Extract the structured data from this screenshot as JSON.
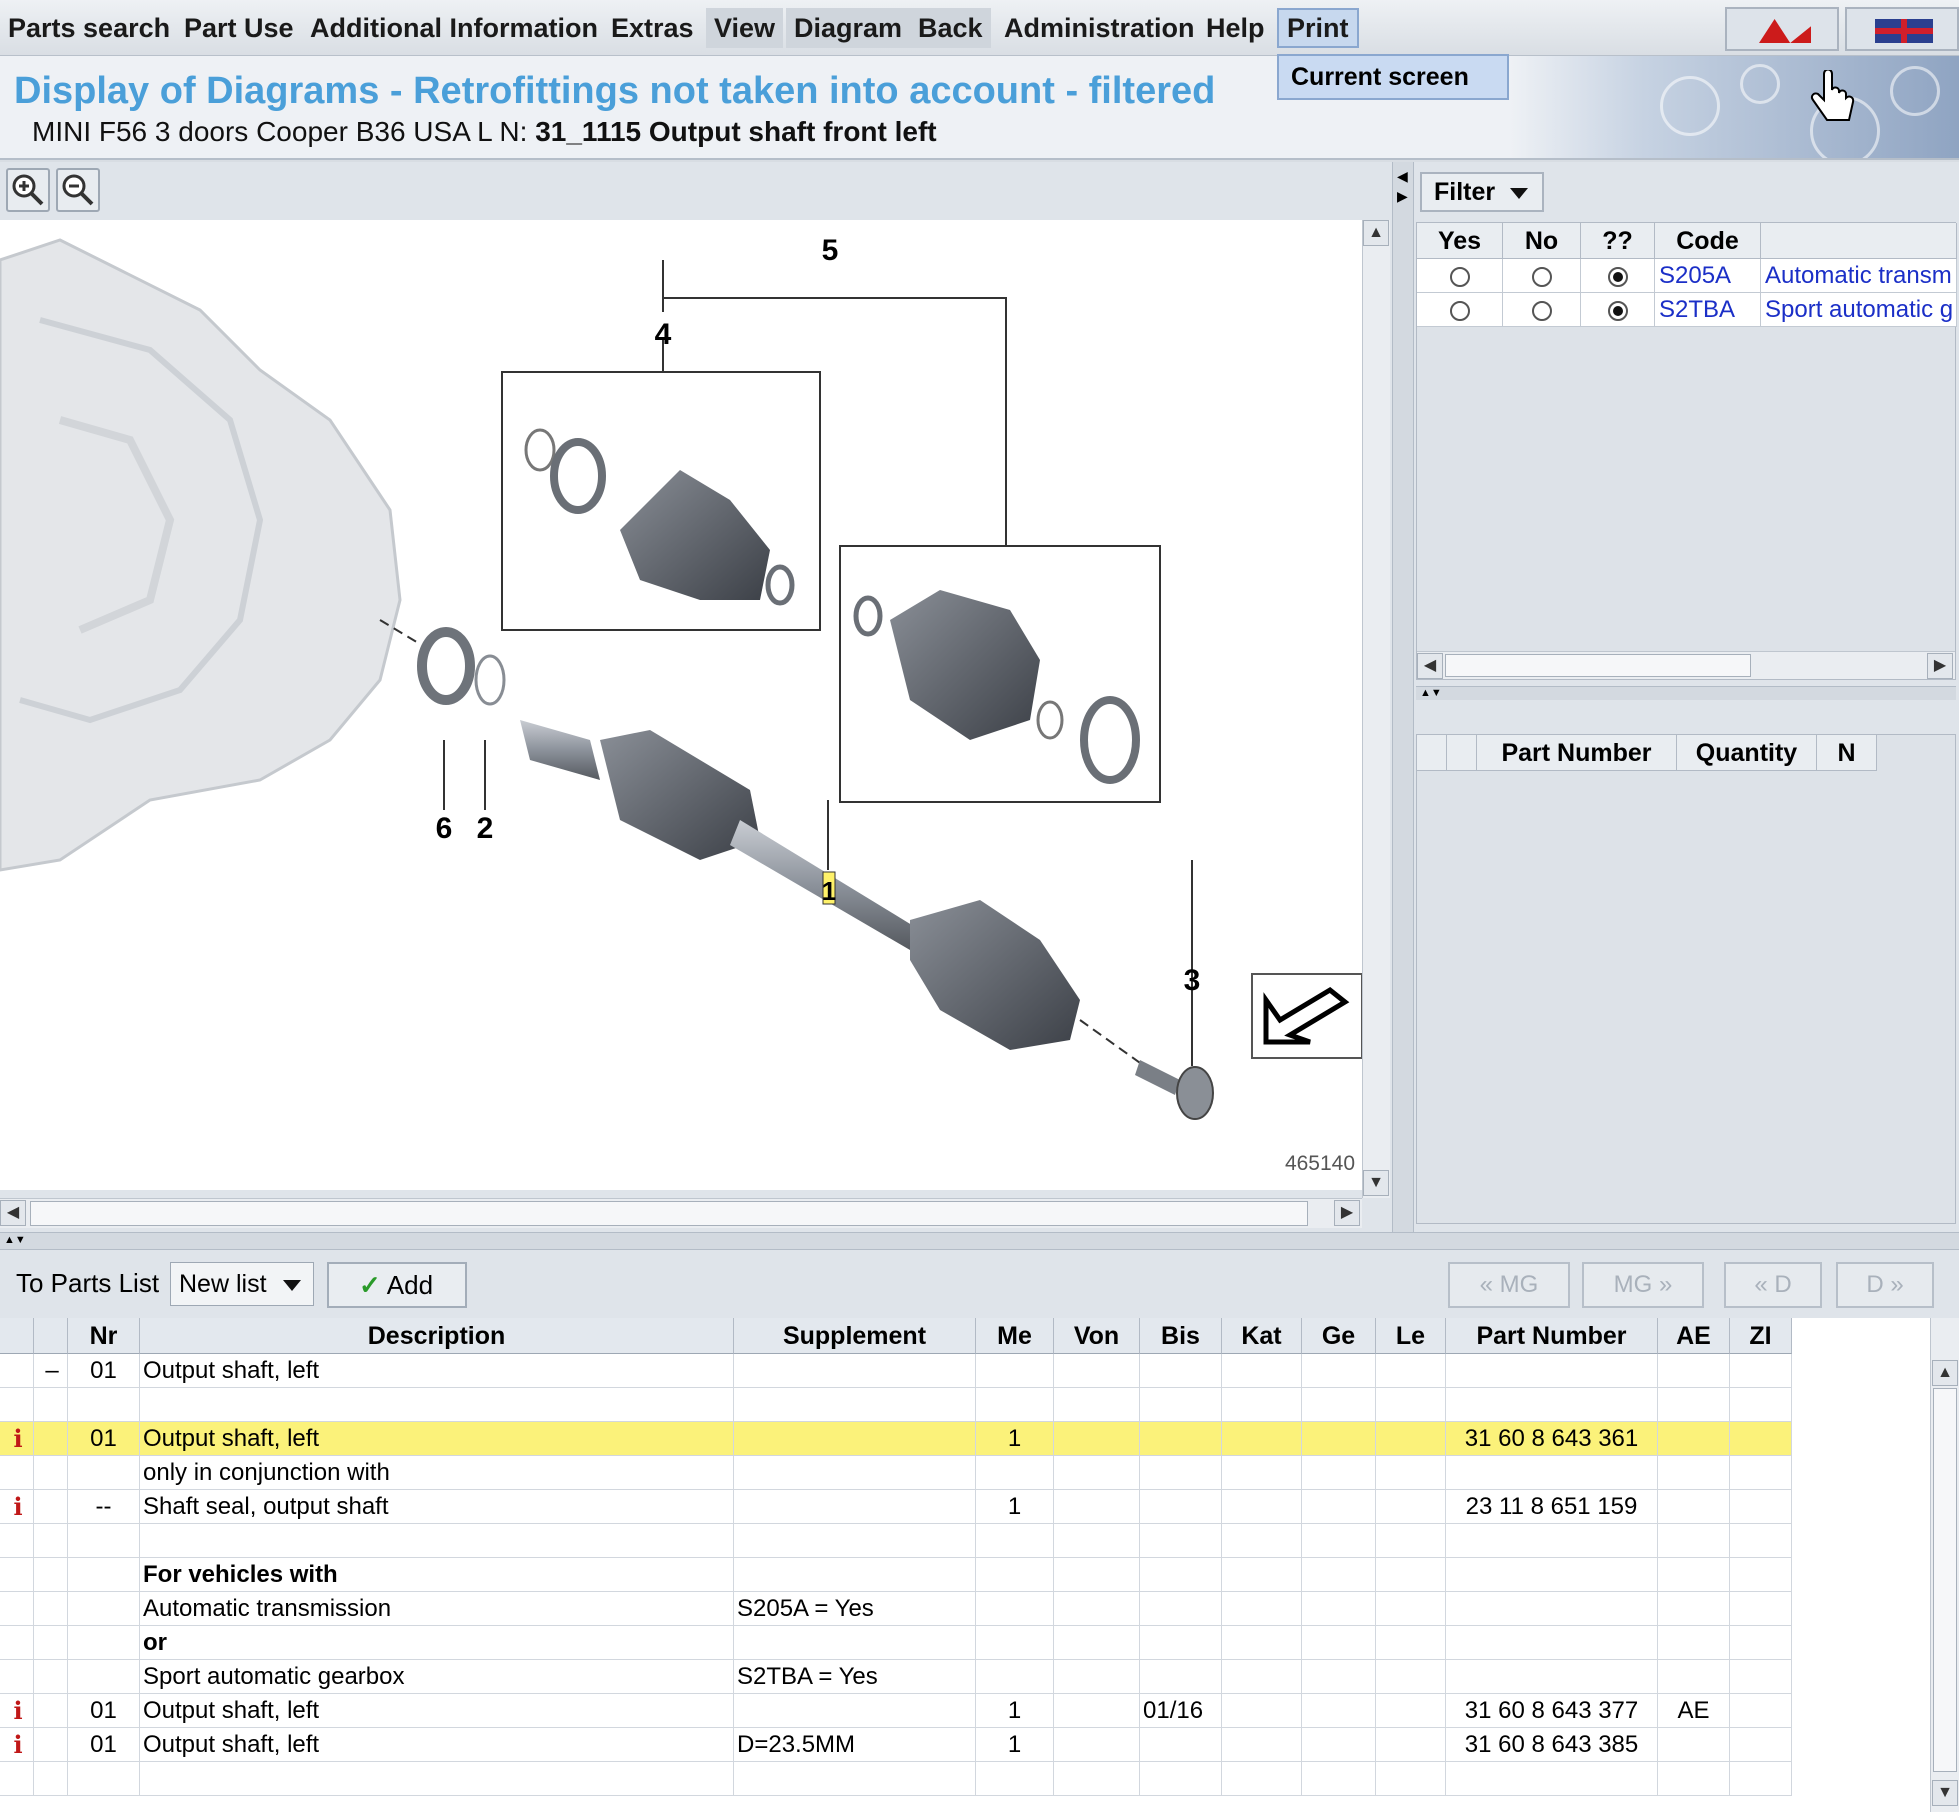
{
  "menu": {
    "items": [
      "Parts search",
      "Part Use",
      "Additional Information",
      "Extras",
      "View",
      "Diagram",
      "Back",
      "Administration",
      "Help",
      "Print"
    ],
    "print_dropdown_item": "Current screen"
  },
  "header": {
    "title": "Display of Diagrams - Retrofittings not taken into account - filtered",
    "vehicle_prefix": "MINI F56 3 doors Cooper B36 USA  L N:",
    "diagram_name": "31_1115 Output shaft front left"
  },
  "diagram": {
    "callouts": [
      "5",
      "4",
      "6",
      "2",
      "1",
      "3"
    ],
    "image_number": "465140"
  },
  "filter": {
    "button_label": "Filter",
    "columns": [
      "Yes",
      "No",
      "??",
      "Code",
      ""
    ],
    "rows": [
      {
        "selected": "??",
        "code": "S205A",
        "description": "Automatic transm"
      },
      {
        "selected": "??",
        "code": "S2TBA",
        "description": "Sport automatic g"
      }
    ],
    "parts_columns": [
      "",
      "",
      "Part Number",
      "Quantity",
      "N"
    ]
  },
  "toolbar": {
    "to_parts_list_label": "To Parts List",
    "list_select_value": "New list",
    "add_label": "Add",
    "nav_buttons": [
      "« MG",
      "MG »",
      "« D",
      "D »"
    ]
  },
  "parts_table": {
    "columns": [
      "",
      "",
      "Nr",
      "Description",
      "Supplement",
      "Me",
      "Von",
      "Bis",
      "Kat",
      "Ge",
      "Le",
      "Part Number",
      "AE",
      "ZI"
    ],
    "rows": [
      {
        "info": "",
        "mark": "–",
        "nr": "01",
        "description": "Output shaft, left",
        "bold": false,
        "supplement": "",
        "me": "",
        "von": "",
        "bis": "",
        "part_number": "",
        "ae": "",
        "highlight": false
      },
      {
        "info": "",
        "mark": "",
        "nr": "",
        "description": "",
        "bold": false,
        "supplement": "",
        "me": "",
        "von": "",
        "bis": "",
        "part_number": "",
        "ae": "",
        "highlight": false
      },
      {
        "info": "i",
        "mark": "",
        "nr": "01",
        "description": "Output shaft, left",
        "bold": false,
        "supplement": "",
        "me": "1",
        "von": "",
        "bis": "",
        "part_number": "31 60 8 643 361",
        "ae": "",
        "highlight": true
      },
      {
        "info": "",
        "mark": "",
        "nr": "",
        "description": "only in conjunction with",
        "bold": false,
        "supplement": "",
        "me": "",
        "von": "",
        "bis": "",
        "part_number": "",
        "ae": "",
        "highlight": false
      },
      {
        "info": "i",
        "mark": "",
        "nr": "--",
        "description": "Shaft seal, output shaft",
        "bold": false,
        "supplement": "",
        "me": "1",
        "von": "",
        "bis": "",
        "part_number": "23 11 8 651 159",
        "ae": "",
        "highlight": false
      },
      {
        "info": "",
        "mark": "",
        "nr": "",
        "description": "",
        "bold": false,
        "supplement": "",
        "me": "",
        "von": "",
        "bis": "",
        "part_number": "",
        "ae": "",
        "highlight": false
      },
      {
        "info": "",
        "mark": "",
        "nr": "",
        "description": "For vehicles with",
        "bold": true,
        "supplement": "",
        "me": "",
        "von": "",
        "bis": "",
        "part_number": "",
        "ae": "",
        "highlight": false
      },
      {
        "info": "",
        "mark": "",
        "nr": "",
        "description": "Automatic transmission",
        "bold": false,
        "supplement": "S205A = Yes",
        "me": "",
        "von": "",
        "bis": "",
        "part_number": "",
        "ae": "",
        "highlight": false
      },
      {
        "info": "",
        "mark": "",
        "nr": "",
        "description": "or",
        "bold": true,
        "supplement": "",
        "me": "",
        "von": "",
        "bis": "",
        "part_number": "",
        "ae": "",
        "highlight": false
      },
      {
        "info": "",
        "mark": "",
        "nr": "",
        "description": "Sport automatic gearbox",
        "bold": false,
        "supplement": "S2TBA = Yes",
        "me": "",
        "von": "",
        "bis": "",
        "part_number": "",
        "ae": "",
        "highlight": false
      },
      {
        "info": "i",
        "mark": "",
        "nr": "01",
        "description": "Output shaft, left",
        "bold": false,
        "supplement": "",
        "me": "1",
        "von": "",
        "bis": "01/16",
        "part_number": "31 60 8 643 377",
        "ae": "AE",
        "highlight": false
      },
      {
        "info": "i",
        "mark": "",
        "nr": "01",
        "description": "Output shaft, left",
        "bold": false,
        "supplement": "D=23.5MM",
        "me": "1",
        "von": "",
        "bis": "",
        "part_number": "31 60 8 643 385",
        "ae": "",
        "highlight": false
      },
      {
        "info": "",
        "mark": "",
        "nr": "",
        "description": "",
        "bold": false,
        "supplement": "",
        "me": "",
        "von": "",
        "bis": "",
        "part_number": "",
        "ae": "",
        "highlight": false
      }
    ]
  },
  "colors": {
    "title": "#4a9fd9",
    "highlight_row": "#fbf27a",
    "link": "#1b2fc7",
    "info_icon": "#c01818"
  }
}
